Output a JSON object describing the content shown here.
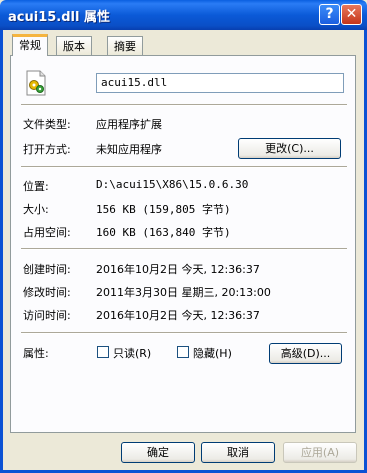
{
  "window": {
    "title": "acui15.dll 属性",
    "help_label": "?",
    "close_label": "✕"
  },
  "tabs": [
    {
      "label": "常规",
      "active": true
    },
    {
      "label": "版本",
      "active": false
    },
    {
      "label": "摘要",
      "active": false
    }
  ],
  "general": {
    "file_icon": "dll-file-icon",
    "file_name": "acui15.dll",
    "type_label": "文件类型:",
    "type_value": "应用程序扩展",
    "opens_with_label": "打开方式:",
    "opens_with_value": "未知应用程序",
    "change_button": "更改(C)...",
    "location_label": "位置:",
    "location_value": "D:\\acui15\\X86\\15.0.6.30",
    "size_label": "大小:",
    "size_value": "156 KB (159,805 字节)",
    "size_on_disk_label": "占用空间:",
    "size_on_disk_value": "160 KB (163,840 字节)",
    "created_label": "创建时间:",
    "created_value": "2016年10月2日 今天, 12:36:37",
    "modified_label": "修改时间:",
    "modified_value": "2011年3月30日 星期三, 20:13:00",
    "accessed_label": "访问时间:",
    "accessed_value": "2016年10月2日 今天, 12:36:37",
    "attributes_label": "属性:",
    "readonly_label": "只读(R)",
    "readonly_checked": false,
    "hidden_label": "隐藏(H)",
    "hidden_checked": false,
    "advanced_button": "高级(D)..."
  },
  "footer": {
    "ok_button": "确定",
    "cancel_button": "取消",
    "apply_button": "应用(A)"
  },
  "colors": {
    "titlebar": "#0a5fe0",
    "face": "#ece9d8",
    "tab_highlight": "#f5b540"
  }
}
